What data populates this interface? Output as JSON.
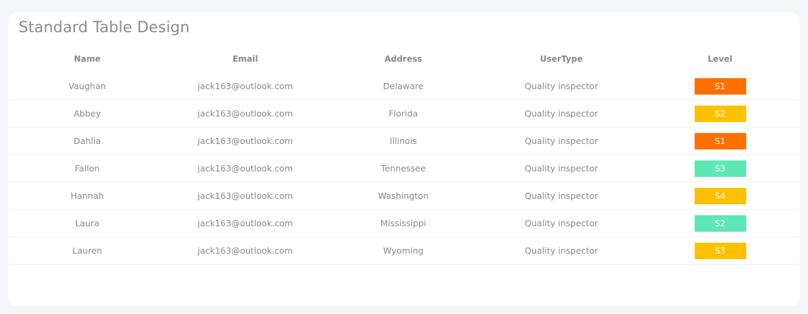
{
  "page": {
    "title": "Standard Table Design"
  },
  "table": {
    "headers": [
      "Name",
      "Email",
      "Address",
      "UserType",
      "Level"
    ],
    "rows": [
      {
        "name": "Vaughan",
        "email": "jack163@outlook.com",
        "address": "Delaware",
        "usertype": "Quality inspector",
        "level": "S1",
        "level_color": "#ff7000"
      },
      {
        "name": "Abbey",
        "email": "jack163@outlook.com",
        "address": "Florida",
        "usertype": "Quality inspector",
        "level": "S2",
        "level_color": "#ffc000"
      },
      {
        "name": "Dahlia",
        "email": "jack163@outlook.com",
        "address": "Illinois",
        "usertype": "Quality inspector",
        "level": "S1",
        "level_color": "#ff7000"
      },
      {
        "name": "Fallon",
        "email": "jack163@outlook.com",
        "address": "Tennessee",
        "usertype": "Quality inspector",
        "level": "S3",
        "level_color": "#5de8b5"
      },
      {
        "name": "Hannah",
        "email": "jack163@outlook.com",
        "address": "Washington",
        "usertype": "Quality inspector",
        "level": "S4",
        "level_color": "#ffc000"
      },
      {
        "name": "Laura",
        "email": "jack163@outlook.com",
        "address": "Mississippi",
        "usertype": "Quality inspector",
        "level": "S2",
        "level_color": "#5de8b5"
      },
      {
        "name": "Lauren",
        "email": "jack163@outlook.com",
        "address": "Wyoming",
        "usertype": "Quality inspector",
        "level": "S3",
        "level_color": "#ffc000"
      }
    ]
  },
  "colors": {
    "background": "#f5f6fa",
    "card": "#ffffff",
    "text": "#8a8a8a",
    "divider": "#f1f1f1"
  }
}
